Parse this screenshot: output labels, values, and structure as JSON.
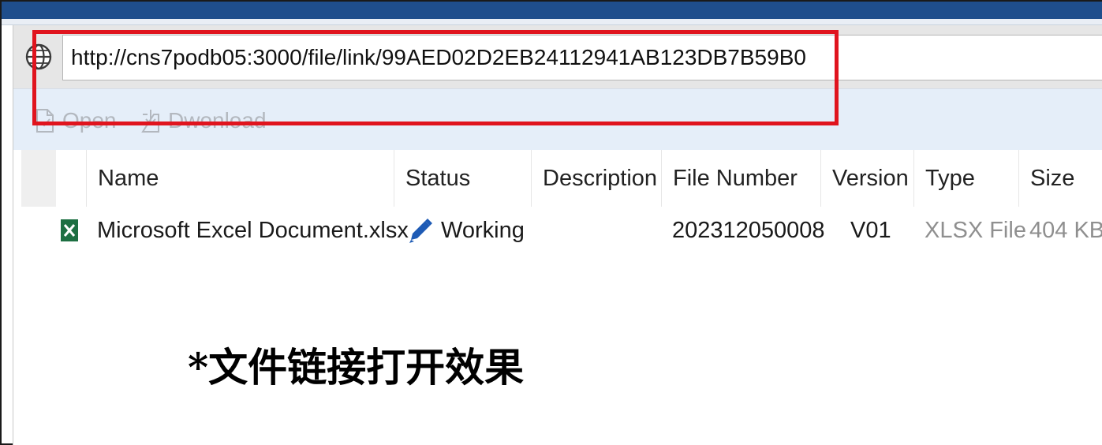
{
  "address_bar": {
    "url": "http://cns7podb05:3000/file/link/99AED02D2EB24112941AB123DB7B59B0",
    "icon": "globe-icon"
  },
  "toolbar": {
    "open_label": "Open",
    "download_label": "Dwonload",
    "open_icon": "document-icon",
    "download_icon": "download-icon"
  },
  "table": {
    "columns": [
      "Name",
      "Status",
      "Description",
      "File Number",
      "Version",
      "Type",
      "Size"
    ],
    "rows": [
      {
        "icon": "excel-icon",
        "name": "Microsoft Excel Document.xlsx",
        "status_icon": "pencil-icon",
        "status": "Working",
        "description": "",
        "file_number": "202312050008",
        "version": "V01",
        "type": "XLSX File",
        "size": "404 KB"
      }
    ]
  },
  "annotation": {
    "text": "*文件链接打开效果"
  },
  "colors": {
    "highlight": "#e0141e",
    "title_bar": "#1f4e8c",
    "toolbar_bg": "#e5eef9",
    "excel_green": "#1d6f42",
    "pencil_blue": "#1e5bb5"
  }
}
